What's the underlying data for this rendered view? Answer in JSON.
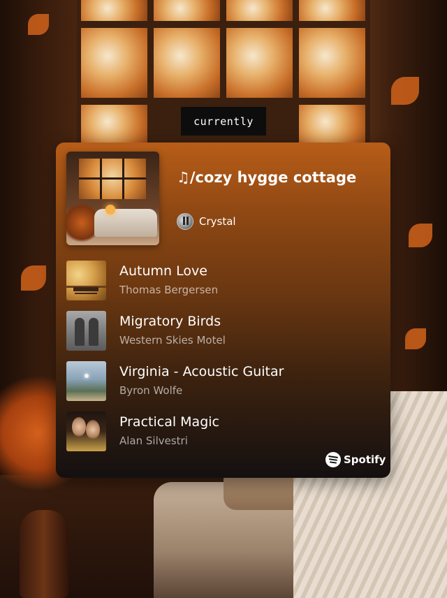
{
  "tag": {
    "text": "currently"
  },
  "playlist": {
    "title": "♫/cozy hygge cottage",
    "owner": "Crystal"
  },
  "tracks": [
    {
      "name": "Autumn Love",
      "artist": "Thomas Bergersen",
      "art": "autumn-bench-art"
    },
    {
      "name": "Migratory Birds",
      "artist": "Western Skies Motel",
      "art": "vintage-photo-art"
    },
    {
      "name": "Virginia - Acoustic Guitar",
      "artist": "Byron Wolfe",
      "art": "landscape-art"
    },
    {
      "name": "Practical Magic",
      "artist": "Alan Silvestri",
      "art": "movie-poster-art"
    }
  ],
  "brand": {
    "name": "Spotify",
    "icon": "spotify-icon"
  },
  "colors": {
    "card_top": "#b75d18",
    "card_bottom": "#141010",
    "tag_bg": "#0d0d0d",
    "text_primary": "#ffffff",
    "text_secondary": "rgba(255,255,255,0.62)"
  }
}
